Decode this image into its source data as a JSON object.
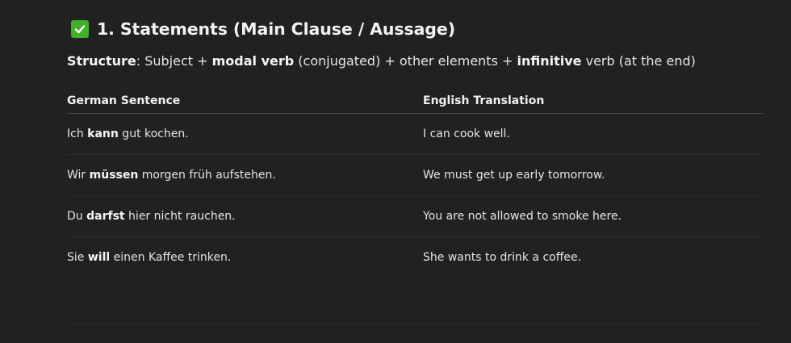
{
  "heading": {
    "icon": "white-check-mark-icon",
    "text": "1. Statements (Main Clause / Aussage)"
  },
  "structure": {
    "label": "Structure",
    "parts": [
      ": Subject + ",
      "modal verb",
      " (conjugated) + other elements + ",
      "infinitive",
      " verb (at the end)"
    ]
  },
  "table": {
    "headers": [
      "German Sentence",
      "English Translation"
    ],
    "rows": [
      {
        "de_pre": "Ich ",
        "de_bold": "kann",
        "de_post": " gut kochen.",
        "en": "I can cook well."
      },
      {
        "de_pre": "Wir ",
        "de_bold": "müssen",
        "de_post": " morgen früh aufstehen.",
        "en": "We must get up early tomorrow."
      },
      {
        "de_pre": "Du ",
        "de_bold": "darfst",
        "de_post": " hier nicht rauchen.",
        "en": "You are not allowed to smoke here."
      },
      {
        "de_pre": "Sie ",
        "de_bold": "will",
        "de_post": " einen Kaffee trinken.",
        "en": "She wants to drink a coffee."
      }
    ]
  },
  "colors": {
    "background": "#212121",
    "text": "#ececec",
    "check_green": "#43b02a"
  }
}
